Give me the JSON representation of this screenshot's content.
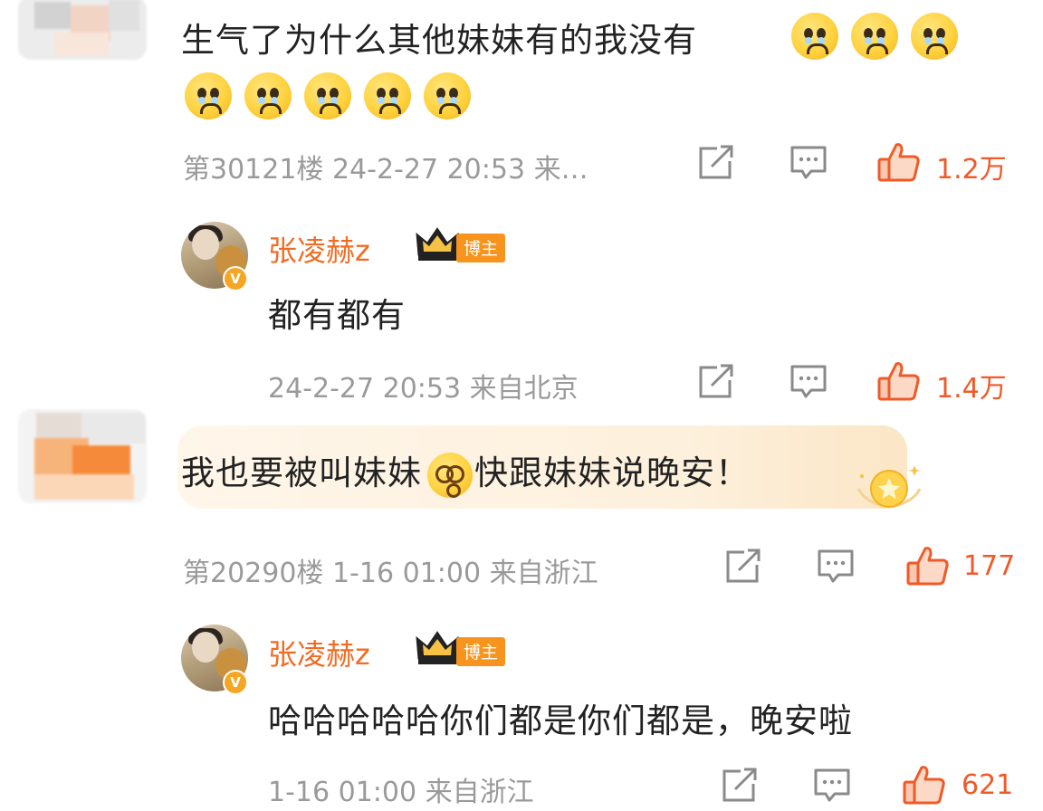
{
  "comments": [
    {
      "text": "生气了为什么其他妹妹有的我没有",
      "emoji": "crying-face-emoji",
      "meta": "第30121楼 24-2-27 20:53 来…",
      "likes": "1.2万",
      "reply": {
        "username": "张凌赫z",
        "badge": "博主",
        "text": "都有都有",
        "meta": "24-2-27 20:53 来自北京",
        "likes": "1.4万"
      }
    },
    {
      "text_before": "我也要被叫妹妹",
      "emoji": "dizzy-face-emoji",
      "text_after": "快跟妹妹说晚安！",
      "meta": "第20290楼 1-16 01:00 来自浙江",
      "likes": "177",
      "reply": {
        "username": "张凌赫z",
        "badge": "博主",
        "text": "哈哈哈哈哈你们都是你们都是，晚安啦",
        "meta": "1-16 01:00 来自浙江",
        "likes": "621"
      }
    }
  ],
  "colors": {
    "accent": "#f05a28",
    "username": "#f26b21",
    "meta": "#9a9a9a",
    "badge": "#f7941d"
  }
}
